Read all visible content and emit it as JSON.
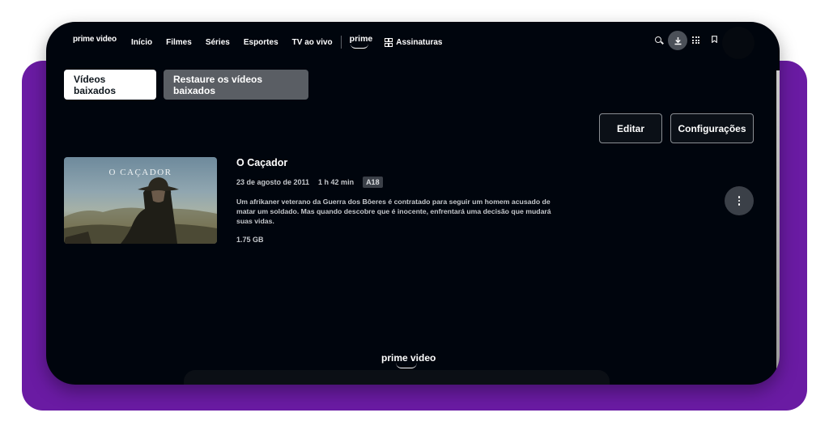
{
  "colors": {
    "background_purple": "#6a1ba3",
    "app_background": "#00050d",
    "primary_button": "#ffffff",
    "secondary_button": "#5a5e64",
    "badge": "#3b4048"
  },
  "nav": {
    "logo": "prime video",
    "items": [
      "Início",
      "Filmes",
      "Séries",
      "Esportes",
      "TV ao vivo"
    ],
    "prime_badge": "prime",
    "subscriptions": "Assinaturas",
    "icons": [
      "search-icon",
      "download-icon",
      "apps-icon",
      "bookmark-icon",
      "avatar"
    ]
  },
  "tabs": {
    "downloaded": "Vídeos baixados",
    "restore": "Restaure os vídeos baixados"
  },
  "actions": {
    "edit": "Editar",
    "settings": "Configurações"
  },
  "video": {
    "thumbnail_title": "O CAÇADOR",
    "title": "O Caçador",
    "date": "23 de agosto de 2011",
    "duration": "1 h 42 min",
    "rating": "A18",
    "description": "Um afrikaner veterano da Guerra dos Bôeres é contratado para seguir um homem acusado de matar um soldado. Mas quando descobre que é inocente, enfrentará uma decisão que mudará suas vidas.",
    "size": "1.75 GB",
    "more_icon": "more-vertical-icon"
  },
  "footer": {
    "logo": "prime video"
  }
}
